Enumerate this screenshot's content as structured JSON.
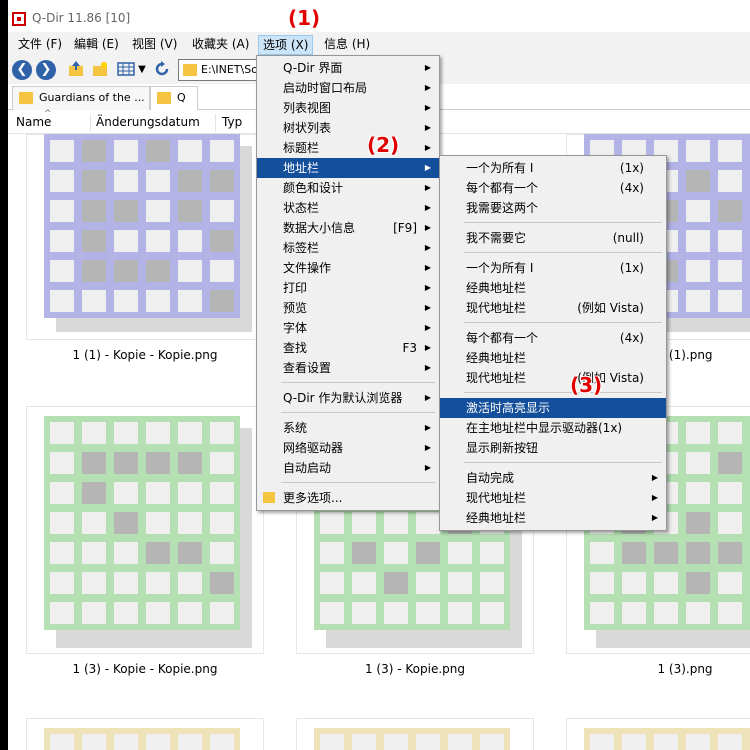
{
  "window": {
    "title": "Q-Dir 11.86 [10]"
  },
  "menubar": [
    "文件 (F)",
    "編輯 (E)",
    "视图 (V)",
    "收藏夹 (A)",
    "选项 (X)",
    "信息 (H)"
  ],
  "toolbar": {
    "back": "❮",
    "forward": "❯",
    "address": "E:\\INET\\Softwar",
    "icons": [
      "back-icon",
      "forward-icon",
      "up-folder-icon",
      "new-folder-icon",
      "view-grid-icon",
      "refresh-icon"
    ]
  },
  "tabs": [
    "Guardians of the ...",
    "Q"
  ],
  "columns": [
    "Name",
    "Änderungsdatum",
    "Typ"
  ],
  "files": [
    "1 (1) - Kopie - Kopie.png",
    "1 (1).png",
    "1 (3) - Kopie - Kopie.png",
    "1 (3) - Kopie.png",
    "1 (3).png"
  ],
  "options_menu": [
    {
      "label": "Q-Dir 界面",
      "arrow": true
    },
    {
      "label": "启动时窗口布局",
      "arrow": true
    },
    {
      "label": "列表视图",
      "arrow": true
    },
    {
      "label": "树状列表",
      "arrow": true
    },
    {
      "label": "标题栏",
      "arrow": true
    },
    {
      "label": "地址栏",
      "arrow": true,
      "highlight": true
    },
    {
      "label": "颜色和设计",
      "arrow": true
    },
    {
      "label": "状态栏",
      "arrow": true
    },
    {
      "label": "数据大小信息",
      "shortcut": "[F9]",
      "arrow": true
    },
    {
      "label": "标签栏",
      "arrow": true
    },
    {
      "label": "文件操作",
      "arrow": true
    },
    {
      "label": "打印",
      "arrow": true
    },
    {
      "label": "预览",
      "arrow": true
    },
    {
      "label": "字体",
      "arrow": true
    },
    {
      "label": "查找",
      "shortcut": "F3",
      "arrow": true
    },
    {
      "label": "查看设置",
      "arrow": true
    },
    {
      "separator": true
    },
    {
      "label": "Q-Dir 作为默认浏览器",
      "arrow": true
    },
    {
      "separator": true
    },
    {
      "label": "系统",
      "arrow": true
    },
    {
      "label": "网络驱动器",
      "arrow": true
    },
    {
      "label": "自动启动",
      "arrow": true
    },
    {
      "separator": true
    },
    {
      "label": "更多选项...",
      "folder": true
    }
  ],
  "address_submenu": [
    {
      "label": "一个为所有 I",
      "shortcut": "(1x)"
    },
    {
      "label": "每个都有一个",
      "shortcut": "(4x)"
    },
    {
      "label": "我需要这两个"
    },
    {
      "separator": true
    },
    {
      "label": "我不需要它",
      "shortcut": "(null)"
    },
    {
      "separator": true
    },
    {
      "label": "一个为所有 I",
      "shortcut": "(1x)"
    },
    {
      "label": "经典地址栏"
    },
    {
      "label": "现代地址栏",
      "shortcut": "(例如 Vista)"
    },
    {
      "separator": true
    },
    {
      "label": "每个都有一个",
      "shortcut": "(4x)"
    },
    {
      "label": "经典地址栏"
    },
    {
      "label": "现代地址栏",
      "shortcut": "(例如 Vista)"
    },
    {
      "separator": true
    },
    {
      "label": "激活时高亮显示",
      "highlight": true
    },
    {
      "label": "在主地址栏中显示驱动器(1x)"
    },
    {
      "label": "显示刷新按钮"
    },
    {
      "separator": true
    },
    {
      "label": "自动完成",
      "arrow": true
    },
    {
      "label": "现代地址栏",
      "arrow": true
    },
    {
      "label": "经典地址栏",
      "arrow": true
    }
  ],
  "annotations": [
    "(1)",
    "(2)",
    "(3)"
  ],
  "colors": {
    "highlight": "#134f9a",
    "annotation": "#e00000",
    "thumb_purple": "#b3b3e8",
    "thumb_green": "#b4e0b4",
    "thumb_yellow": "#ede2b8"
  }
}
